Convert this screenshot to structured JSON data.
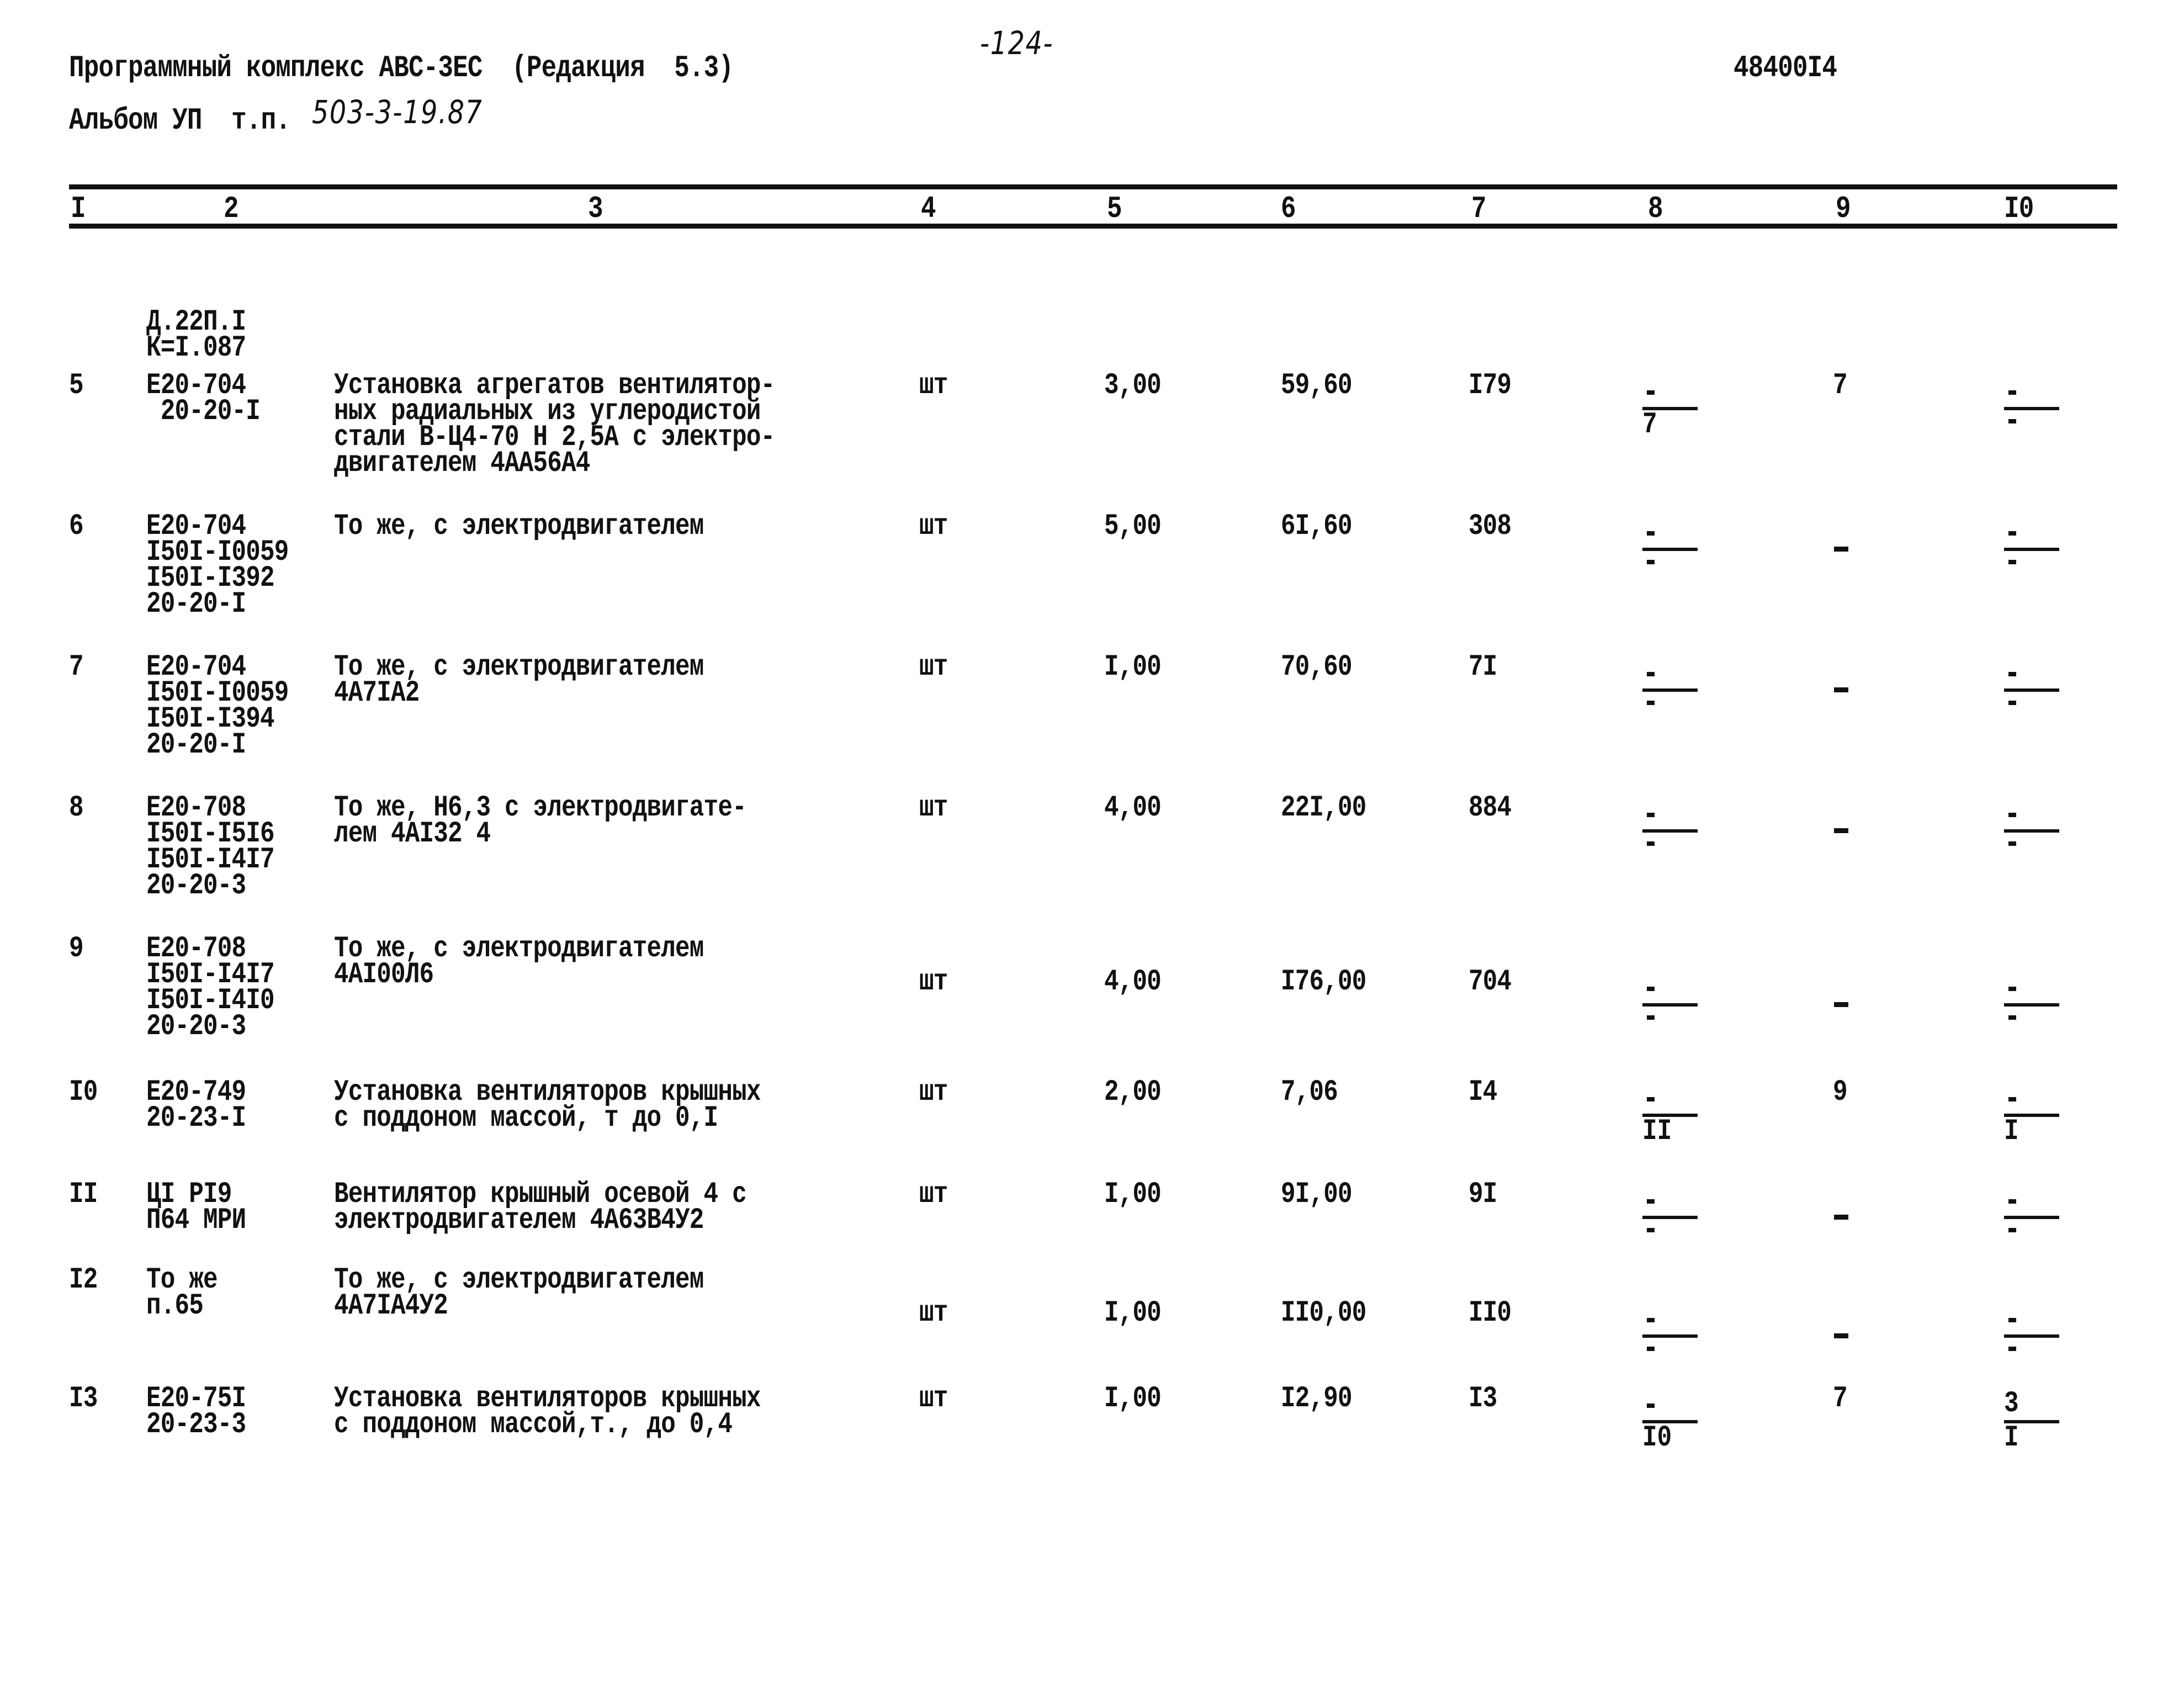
{
  "header": {
    "program": "Программный комплекс АВС-3ЕС  (Редакция  5.3)",
    "album_prefix": "Альбом УП  т.п.",
    "album_handwritten": "503-3-19.87",
    "page_number": "-124-",
    "doc_code": "48400I4"
  },
  "columns": [
    "I",
    "2",
    "3",
    "4",
    "5",
    "6",
    "7",
    "8",
    "9",
    "I0"
  ],
  "carryover": {
    "code_lines": [
      "Д.22П.I",
      "К=I.087"
    ]
  },
  "rows": [
    {
      "no": "5",
      "code_lines": [
        "Е20-704",
        " 20-20-I"
      ],
      "desc_lines": [
        "Установка агрегатов вентилятор-",
        "ных радиальных из углеродистой",
        "стали В-Ц4-70 Н 2,5А с электро-",
        "двигателем 4АА56А4"
      ],
      "unit": "шт",
      "qty": "3,00",
      "price": "59,60",
      "total": "I79",
      "c8": {
        "num": "-",
        "den": "7"
      },
      "c9": "7",
      "c10": {
        "num": "-",
        "den": "-"
      }
    },
    {
      "no": "6",
      "code_lines": [
        "Е20-704",
        "I50I-I0059",
        "I50I-I392",
        "20-20-I"
      ],
      "desc_lines": [
        "То же, с электродвигателем"
      ],
      "unit": "шт",
      "qty": "5,00",
      "price": "6I,60",
      "total": "308",
      "c8": {
        "num": "-",
        "den": "-"
      },
      "c9": "-",
      "c10": {
        "num": "-",
        "den": "-"
      }
    },
    {
      "no": "7",
      "code_lines": [
        "Е20-704",
        "I50I-I0059",
        "I50I-I394",
        "20-20-I"
      ],
      "desc_lines": [
        "То же, с электродвигателем",
        "4А7IА2"
      ],
      "unit": "шт",
      "qty": "I,00",
      "price": "70,60",
      "total": "7I",
      "c8": {
        "num": "-",
        "den": "-"
      },
      "c9": "-",
      "c10": {
        "num": "-",
        "den": "-"
      }
    },
    {
      "no": "8",
      "code_lines": [
        "Е20-708",
        "I50I-I5I6",
        "I50I-I4I7",
        "20-20-3"
      ],
      "desc_lines": [
        "То же, Н6,3 с электродвигате-",
        "лем 4АI32 4"
      ],
      "unit": "шт",
      "qty": "4,00",
      "price": "22I,00",
      "total": "884",
      "c8": {
        "num": "-",
        "den": "-"
      },
      "c9": "-",
      "c10": {
        "num": "-",
        "den": "-"
      }
    },
    {
      "no": "9",
      "code_lines": [
        "Е20-708",
        "I50I-I4I7",
        "I50I-I4I0",
        "20-20-3"
      ],
      "desc_lines": [
        "То же, с электродвигателем",
        "4АI00Л6"
      ],
      "unit": "шт",
      "qty": "4,00",
      "price": "I76,00",
      "total": "704",
      "c8": {
        "num": "-",
        "den": "-"
      },
      "c9": "-",
      "c10": {
        "num": "-",
        "den": "-"
      }
    },
    {
      "no": "I0",
      "code_lines": [
        "Е20-749",
        "20-23-I"
      ],
      "desc_lines": [
        "Установка вентиляторов крышных",
        "с поддоном массой, т до 0,I"
      ],
      "unit": "шт",
      "qty": "2,00",
      "price": "7,06",
      "total": "I4",
      "c8": {
        "num": "-",
        "den": "II"
      },
      "c9": "9",
      "c10": {
        "num": "-",
        "den": "I"
      }
    },
    {
      "no": "II",
      "code_lines": [
        "ЦI РI9",
        "П64 МРИ"
      ],
      "desc_lines": [
        "Вентилятор крышный осевой 4 с",
        "электродвигателем 4А63В4У2"
      ],
      "unit": "шт",
      "qty": "I,00",
      "price": "9I,00",
      "total": "9I",
      "c8": {
        "num": "-",
        "den": "-"
      },
      "c9": "-",
      "c10": {
        "num": "-",
        "den": "-"
      }
    },
    {
      "no": "I2",
      "code_lines": [
        "То же",
        "п.65"
      ],
      "desc_lines": [
        "То же, с электродвигателем",
        "4А7IА4У2"
      ],
      "unit": "шт",
      "qty": "I,00",
      "price": "II0,00",
      "total": "II0",
      "c8": {
        "num": "-",
        "den": "-"
      },
      "c9": "-",
      "c10": {
        "num": "-",
        "den": "-"
      }
    },
    {
      "no": "I3",
      "code_lines": [
        "Е20-75I",
        "20-23-3"
      ],
      "desc_lines": [
        "Установка вентиляторов крышных",
        "с поддоном массой,т., до 0,4"
      ],
      "unit": "шт",
      "qty": "I,00",
      "price": "I2,90",
      "total": "I3",
      "c8": {
        "num": "-",
        "den": "I0"
      },
      "c9": "7",
      "c10": {
        "num": "3",
        "den": "I"
      }
    }
  ]
}
